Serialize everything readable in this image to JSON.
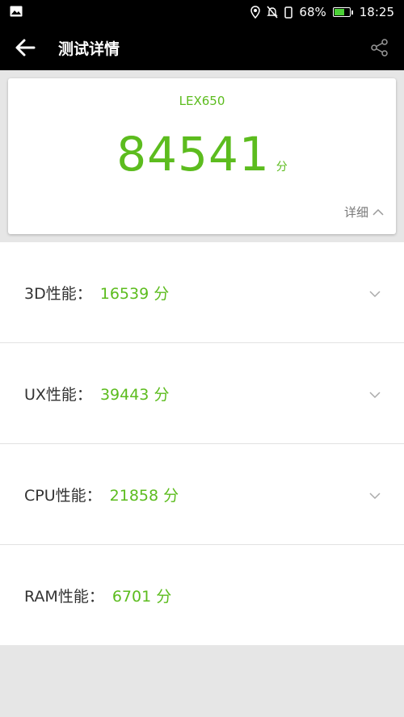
{
  "status_bar": {
    "battery_percent_text": "68%",
    "time": "18:25",
    "battery_level": 0.68,
    "icons": [
      "image-icon",
      "location-icon",
      "mute-icon",
      "portrait-lock-icon",
      "battery-icon"
    ]
  },
  "app_bar": {
    "title": "测试详情",
    "icons": [
      "back-arrow-icon",
      "share-icon"
    ]
  },
  "score_card": {
    "device": "LEX650",
    "total_score": "84541",
    "unit": "分",
    "detail_label": "详细"
  },
  "results": [
    {
      "label": "3D性能：",
      "score": "16539",
      "unit": "分",
      "expandable": true
    },
    {
      "label": "UX性能：",
      "score": "39443",
      "unit": "分",
      "expandable": true
    },
    {
      "label": "CPU性能：",
      "score": "21858",
      "unit": "分",
      "expandable": true
    },
    {
      "label": "RAM性能：",
      "score": "6701",
      "unit": "分",
      "expandable": false
    }
  ],
  "colors": {
    "accent": "#5cbc1e",
    "bar": "#000000",
    "background": "#e6e6e6"
  }
}
